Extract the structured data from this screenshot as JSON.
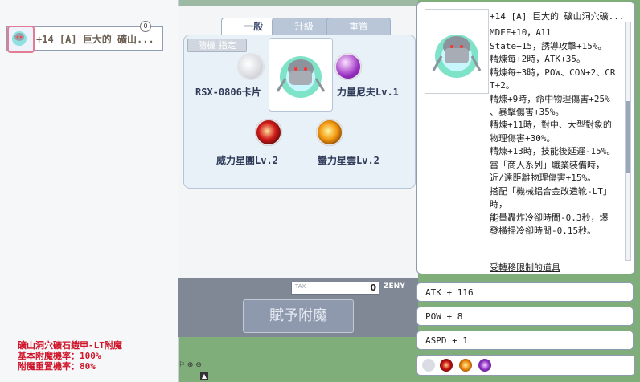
{
  "left": {
    "item_name": "+14 [A] 巨大的 礦山...",
    "badge": "0"
  },
  "tabs": [
    "一般",
    "升級",
    "重置"
  ],
  "random_button": "隨機 指定",
  "slots": {
    "card": "RSX-0806卡片",
    "purple": "力量尼夫Lv.1",
    "red": "威力星團Lv.2",
    "orange": "蠻力星雲Lv.2"
  },
  "tax": {
    "label": "TAX",
    "value": "0",
    "currency": "ZENY"
  },
  "grant_button": "賦予附魔",
  "info": {
    "line1": "礦山洞穴礦石鎧甲-LT附魔",
    "line2": "基本附魔機率：100%",
    "line3": "附魔重置機率：80%"
  },
  "tooltip": {
    "title": "+14 [A] 巨大的 礦山洞穴礦...",
    "lines": [
      "MDEF+10，All",
      "State+15，誘導攻擊+15%。",
      "精煉每+2時，ATK+35。",
      "精煉每+3時，POW、CON+2、CR",
      "T+2。",
      "精煉+9時，命中物理傷害+25%",
      "、暴擊傷害+35%。"
    ],
    "lines_wide": [
      "精煉+11時，對中、大型對象的",
      "物理傷害+30%。",
      "精煉+13時，技能後延遲-15%。",
      "當「商人系列」職業裝備時，",
      "近/遠距離物理傷害+15%。",
      "搭配「機械鋁合金改造靴-LT」",
      "時，",
      "能量轟炸冷卻時間-0.3秒，爆",
      "發橫掃冷卻時間-0.15秒。"
    ],
    "restriction": "受轉移限制的道具"
  },
  "stats": {
    "atk": "ATK + 116",
    "pow": "POW + 8",
    "aspd": "ASPD + 1"
  }
}
